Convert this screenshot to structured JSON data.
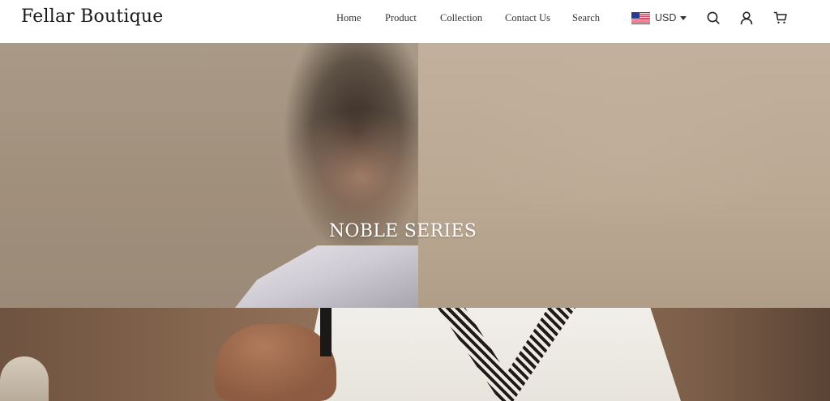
{
  "brand": {
    "name": "Fellar Boutique"
  },
  "nav": {
    "items": [
      {
        "label": "Home"
      },
      {
        "label": "Product"
      },
      {
        "label": "Collection"
      },
      {
        "label": "Contact Us"
      },
      {
        "label": "Search"
      }
    ]
  },
  "currency": {
    "code": "USD",
    "flag_icon": "us-flag-icon"
  },
  "header_icons": [
    "search-icon",
    "user-icon",
    "cart-icon"
  ],
  "hero": {
    "title": "NOBLE SERIES"
  }
}
